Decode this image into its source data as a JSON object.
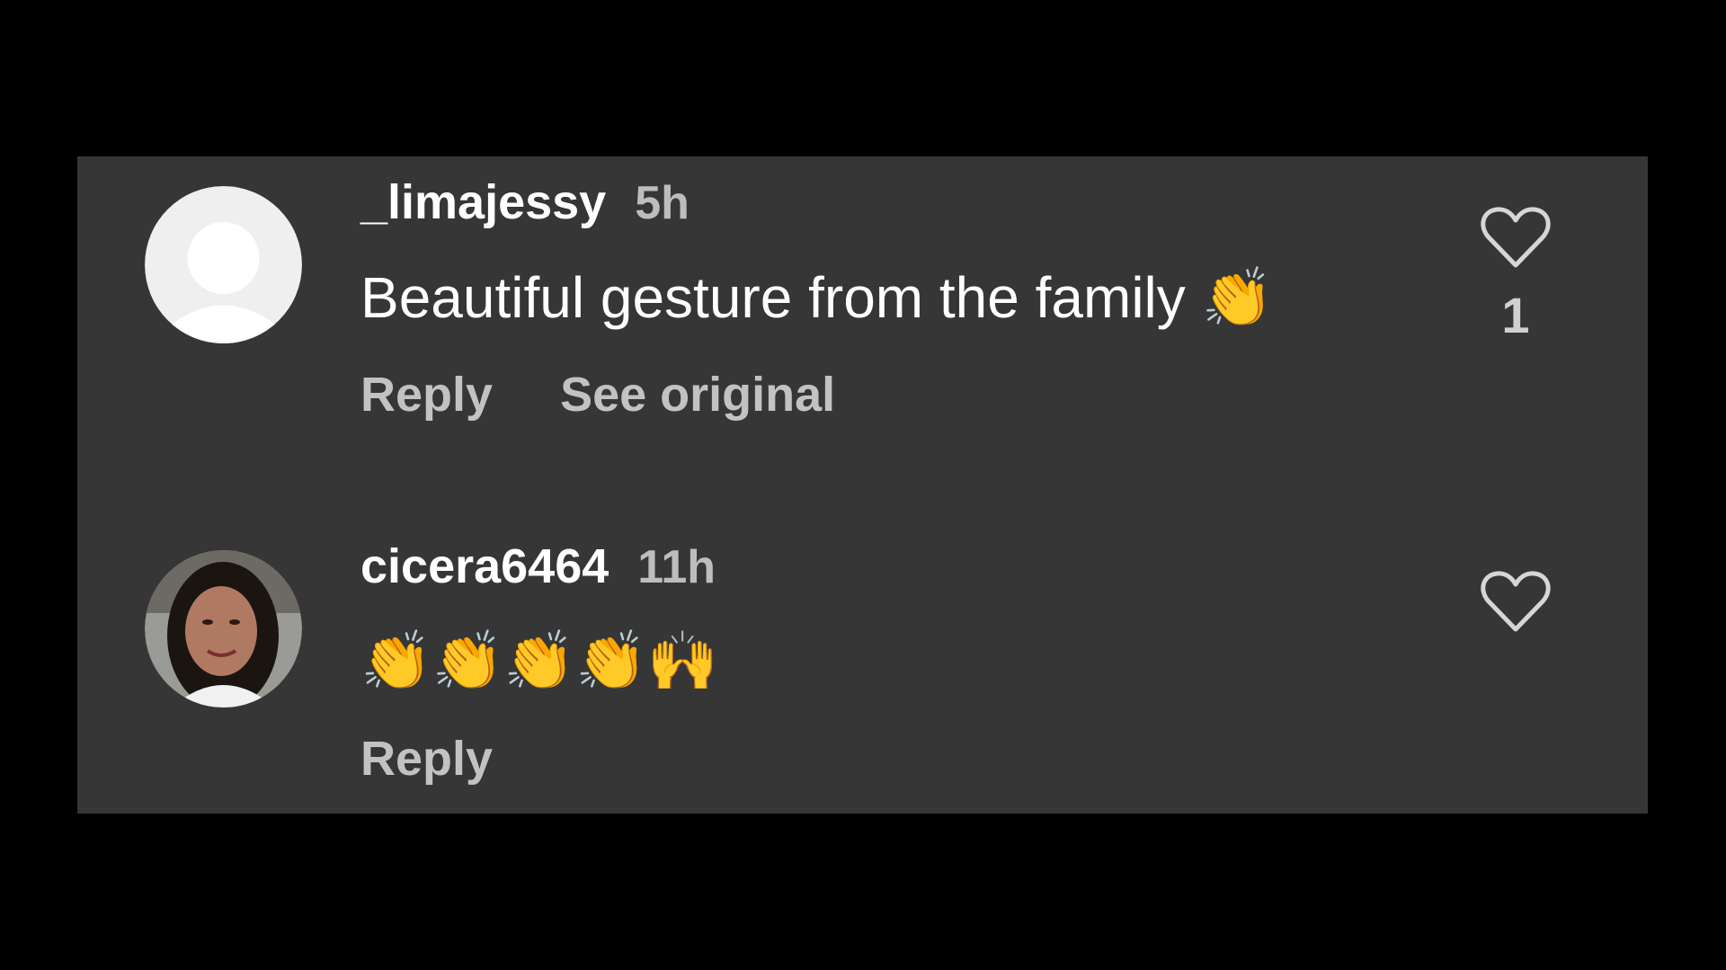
{
  "comments": [
    {
      "username": "_limajessy",
      "time": "5h",
      "text": "Beautiful gesture from the family 👏",
      "actions": {
        "reply": "Reply",
        "see_original": "See original"
      },
      "like_count": "1",
      "avatar": "default-avatar"
    },
    {
      "username": "cicera6464",
      "time": "11h",
      "text": "👏👏👏👏🙌",
      "actions": {
        "reply": "Reply"
      },
      "avatar": "user-photo"
    }
  ],
  "colors": {
    "background": "#000000",
    "panel": "#363636",
    "username": "#ffffff",
    "secondary_text": "#bdbdbd"
  }
}
